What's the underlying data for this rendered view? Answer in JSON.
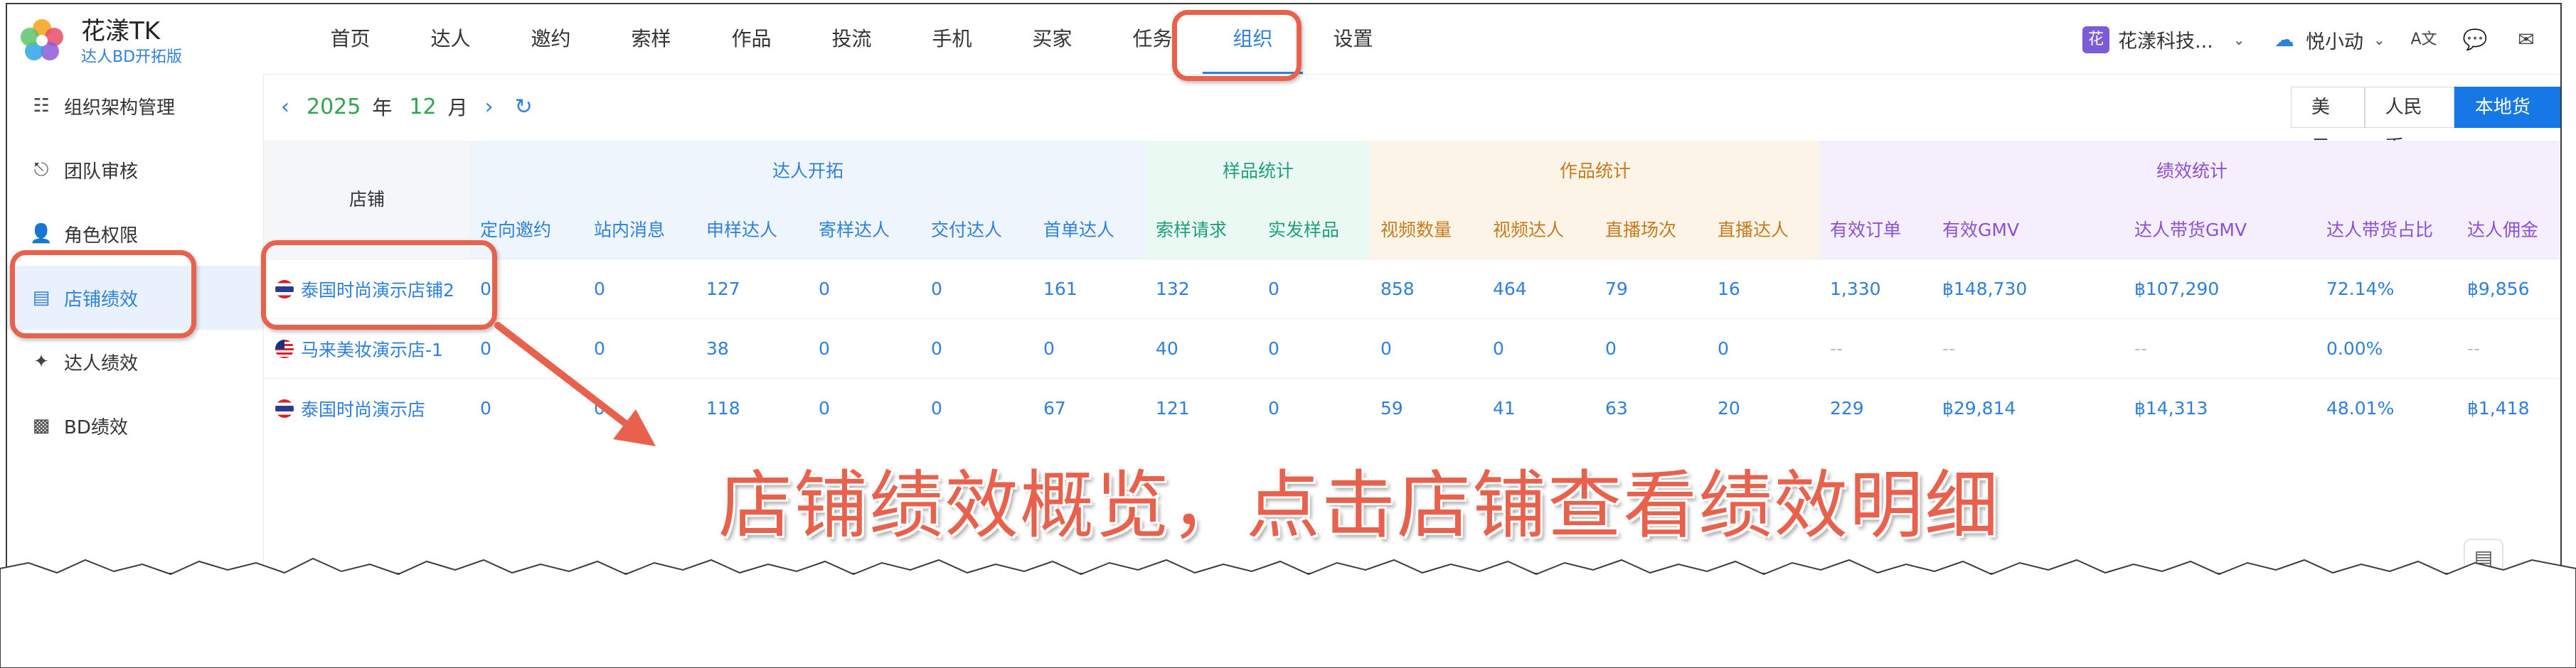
{
  "brand": {
    "title": "花漾TK",
    "subtitle": "达人BD开拓版"
  },
  "nav": {
    "items": [
      {
        "label": "首页"
      },
      {
        "label": "达人"
      },
      {
        "label": "邀约"
      },
      {
        "label": "索样"
      },
      {
        "label": "作品"
      },
      {
        "label": "投流"
      },
      {
        "label": "手机"
      },
      {
        "label": "买家"
      },
      {
        "label": "任务"
      },
      {
        "label": "组织",
        "active": true
      },
      {
        "label": "设置"
      }
    ],
    "tenant": {
      "icon_text": "花",
      "name": "花漾科技..."
    },
    "app2": {
      "name": "悦小动"
    },
    "icons": [
      "translate-icon",
      "chat-icon",
      "mail-icon"
    ]
  },
  "sidebar": {
    "items": [
      {
        "label": "组织架构管理",
        "icon": "org-chart-icon"
      },
      {
        "label": "团队审核",
        "icon": "stamp-icon"
      },
      {
        "label": "角色权限",
        "icon": "user-role-icon"
      },
      {
        "label": "店铺绩效",
        "icon": "shop-icon",
        "active": true
      },
      {
        "label": "达人绩效",
        "icon": "creator-icon"
      },
      {
        "label": "BD绩效",
        "icon": "bar-chart-icon"
      }
    ]
  },
  "date": {
    "year": "2025",
    "year_unit": "年",
    "month": "12",
    "month_unit": "月"
  },
  "currency": {
    "options": [
      "美元",
      "人民币",
      "本地货币"
    ],
    "active": "本地货币"
  },
  "table": {
    "shop_header": "店铺",
    "groups": [
      {
        "label": "达人开拓",
        "color": "#2f7fdc",
        "bg": "#eef5fd"
      },
      {
        "label": "样品统计",
        "color": "#1f9e7a",
        "bg": "#eafaf3"
      },
      {
        "label": "作品统计",
        "color": "#c57a1e",
        "bg": "#fdf4e8"
      },
      {
        "label": "绩效统计",
        "color": "#8a4fd4",
        "bg": "#f5effd"
      }
    ],
    "columns": [
      {
        "label": "定向邀约",
        "group": 0
      },
      {
        "label": "站内消息",
        "group": 0
      },
      {
        "label": "申样达人",
        "group": 0
      },
      {
        "label": "寄样达人",
        "group": 0
      },
      {
        "label": "交付达人",
        "group": 0
      },
      {
        "label": "首单达人",
        "group": 0
      },
      {
        "label": "索样请求",
        "group": 1
      },
      {
        "label": "实发样品",
        "group": 1
      },
      {
        "label": "视频数量",
        "group": 2
      },
      {
        "label": "视频达人",
        "group": 2
      },
      {
        "label": "直播场次",
        "group": 2
      },
      {
        "label": "直播达人",
        "group": 2
      },
      {
        "label": "有效订单",
        "group": 3
      },
      {
        "label": "有效GMV",
        "group": 3
      },
      {
        "label": "达人带货GMV",
        "group": 3
      },
      {
        "label": "达人带货占比",
        "group": 3
      },
      {
        "label": "达人佣金",
        "group": 3
      }
    ],
    "rows": [
      {
        "shop": "泰国时尚演示店铺2",
        "flag": "th",
        "values": [
          "0",
          "0",
          "127",
          "0",
          "0",
          "161",
          "132",
          "0",
          "858",
          "464",
          "79",
          "16",
          "1,330",
          "฿148,730",
          "฿107,290",
          "72.14%",
          "฿9,856"
        ]
      },
      {
        "shop": "马来美妆演示店-1",
        "flag": "my",
        "values": [
          "0",
          "0",
          "38",
          "0",
          "0",
          "0",
          "40",
          "0",
          "0",
          "0",
          "0",
          "0",
          "--",
          "--",
          "--",
          "0.00%",
          "--"
        ]
      },
      {
        "shop": "泰国时尚演示店",
        "flag": "th",
        "values": [
          "0",
          "0",
          "118",
          "0",
          "0",
          "67",
          "121",
          "0",
          "59",
          "41",
          "63",
          "20",
          "229",
          "฿29,814",
          "฿14,313",
          "48.01%",
          "฿1,418"
        ]
      }
    ]
  },
  "annotation": {
    "text": "店铺绩效概览，点击店铺查看绩效明细",
    "color": "#e8614c"
  }
}
